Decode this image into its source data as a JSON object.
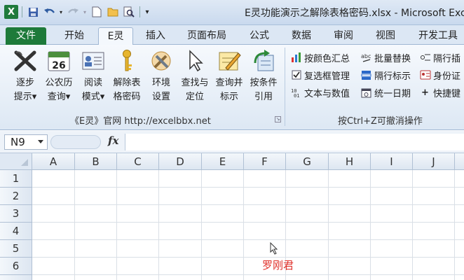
{
  "window": {
    "title": "E灵功能演示之解除表格密码.xlsx - Microsoft Exce",
    "app_logo": "X"
  },
  "tabs": [
    "文件",
    "开始",
    "E灵",
    "插入",
    "页面布局",
    "公式",
    "数据",
    "审阅",
    "视图",
    "开发工具"
  ],
  "ribbon": {
    "big_buttons": [
      {
        "line1": "逐步",
        "line2": "提示▾",
        "icon": "x-wave-icon"
      },
      {
        "line1": "公农历",
        "line2": "查询▾",
        "icon": "calendar-icon",
        "icon_text": "26"
      },
      {
        "line1": "阅读",
        "line2": "模式▾",
        "icon": "reading-card-icon"
      },
      {
        "line1": "解除表",
        "line2": "格密码",
        "icon": "key-icon"
      },
      {
        "line1": "环境",
        "line2": "设置",
        "icon": "tools-icon"
      },
      {
        "line1": "查找与",
        "line2": "定位",
        "icon": "pointer-icon"
      },
      {
        "line1": "查询并",
        "line2": "标示",
        "icon": "pencil-note-icon"
      },
      {
        "line1": "按条件",
        "line2": "引用",
        "icon": "reference-icon"
      }
    ],
    "small_buttons": [
      {
        "label": "按颜色汇总",
        "icon": "color-bars-icon"
      },
      {
        "label": "批量替换",
        "icon": "abc-replace-icon"
      },
      {
        "label": "隔行插",
        "icon": "insert-rows-icon"
      },
      {
        "label": "复选框管理",
        "icon": "checkbox-icon"
      },
      {
        "label": "隔行标示",
        "icon": "alt-rows-icon"
      },
      {
        "label": "身份证",
        "icon": "id-card-icon"
      },
      {
        "label": "文本与数值",
        "icon": "text-number-icon"
      },
      {
        "label": "统一日期",
        "icon": "date-icon"
      },
      {
        "label": "快捷键",
        "icon": "plus-icon"
      }
    ],
    "group1_label": "《E灵》官网  http://excelbbx.net",
    "group2_label": "按Ctrl+Z可撤消操作"
  },
  "formula_bar": {
    "name_box": "N9",
    "fx": "fx",
    "formula": ""
  },
  "sheet": {
    "columns": [
      "A",
      "B",
      "C",
      "D",
      "E",
      "F",
      "G",
      "H",
      "I",
      "J"
    ],
    "rows": [
      "1",
      "2",
      "3",
      "4",
      "5",
      "6"
    ],
    "cell_F6": "罗刚君"
  },
  "colors": {
    "file_tab": "#1e7a3a",
    "cell_text": "#e0302a"
  }
}
